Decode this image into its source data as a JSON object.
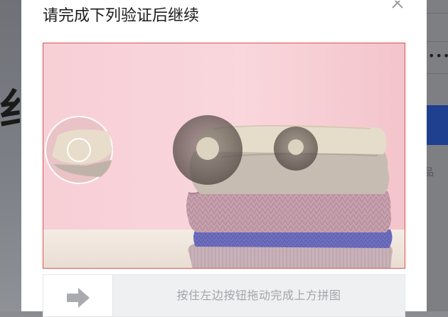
{
  "modal": {
    "title": "请完成下列验证后继续",
    "slider_hint": "按住左边按钮拖动完成上方拼图"
  },
  "background": {
    "partial_char": "纟",
    "masked_password": "••••",
    "glyph": "品"
  },
  "icons": {
    "close": "close-icon",
    "slider": "arrow-right-icon"
  },
  "colors": {
    "puzzle_border": "#d9534f",
    "backdrop_blue": "#1f3f8f",
    "hint_text": "#a2a5aa"
  }
}
